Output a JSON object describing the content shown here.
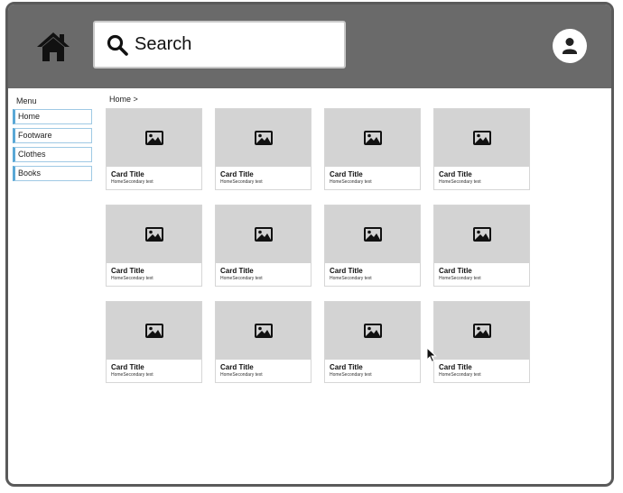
{
  "header": {
    "home_icon": "home-icon",
    "profile_icon": "user-icon"
  },
  "search": {
    "placeholder": "Search",
    "icon": "search-icon"
  },
  "sidebar": {
    "title": "Menu",
    "items": [
      {
        "label": "Home"
      },
      {
        "label": "Footware"
      },
      {
        "label": "Clothes"
      },
      {
        "label": "Books"
      }
    ]
  },
  "breadcrumb": "Home >",
  "cards": [
    {
      "title": "Card Title",
      "subtitle": "HomeSecondary text",
      "icon": "image-placeholder-icon"
    },
    {
      "title": "Card Title",
      "subtitle": "HomeSecondary text",
      "icon": "image-placeholder-icon"
    },
    {
      "title": "Card Title",
      "subtitle": "HomeSecondary text",
      "icon": "image-placeholder-icon"
    },
    {
      "title": "Card Title",
      "subtitle": "HomeSecondary text",
      "icon": "image-placeholder-icon"
    },
    {
      "title": "Card Title",
      "subtitle": "HomeSecondary text",
      "icon": "image-placeholder-icon"
    },
    {
      "title": "Card Title",
      "subtitle": "HomeSecondary text",
      "icon": "image-placeholder-icon"
    },
    {
      "title": "Card Title",
      "subtitle": "HomeSecondary text",
      "icon": "image-placeholder-icon"
    },
    {
      "title": "Card Title",
      "subtitle": "HomeSecondary text",
      "icon": "image-placeholder-icon"
    },
    {
      "title": "Card Title",
      "subtitle": "HomeSecondary text",
      "icon": "image-placeholder-icon"
    },
    {
      "title": "Card Title",
      "subtitle": "HomeSecondary text",
      "icon": "image-placeholder-icon"
    },
    {
      "title": "Card Title",
      "subtitle": "HomeSecondary text",
      "icon": "image-placeholder-icon"
    },
    {
      "title": "Card Title",
      "subtitle": "HomeSecondary text",
      "icon": "image-placeholder-icon"
    }
  ],
  "colors": {
    "header_bg": "#6a6a6a",
    "card_media_bg": "#d3d3d3",
    "sidebar_accent": "#5aa8d6"
  }
}
